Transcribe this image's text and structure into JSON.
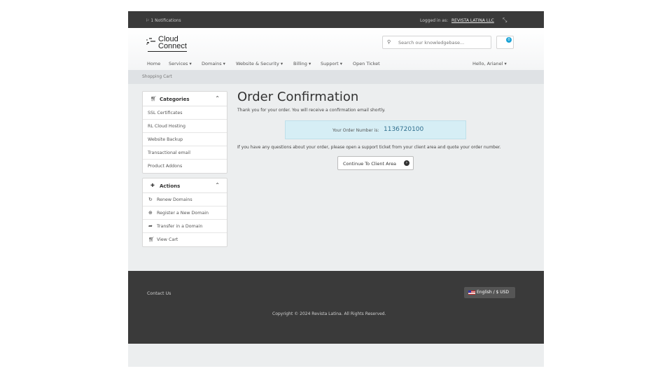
{
  "topbar": {
    "notifications": "1 Notifications",
    "logged_in_label": "Logged in as:",
    "account_name": "REVISTA LATINA LLC"
  },
  "header": {
    "logo_line1": "Cloud",
    "logo_line2": "Connect",
    "search_placeholder": "Search our knowledgebase...",
    "cart_count": "0"
  },
  "nav": {
    "items": [
      "Home",
      "Services ▾",
      "Domains ▾",
      "Website & Security ▾",
      "Billing ▾",
      "Support ▾",
      "Open Ticket"
    ],
    "greeting": "Hello, Arianel ▾"
  },
  "breadcrumb": "Shopping Cart",
  "sidebar": {
    "categories_title": "Categories",
    "categories": [
      "SSL Certificates",
      "RL Cloud Hosting",
      "Website Backup",
      "Transactional email",
      "Product Addons"
    ],
    "actions_title": "Actions",
    "actions": [
      "Renew Domains",
      "Register a New Domain",
      "Transfer in a Domain",
      "View Cart"
    ]
  },
  "main": {
    "title": "Order Confirmation",
    "thanks": "Thank you for your order. You will receive a confirmation email shortly.",
    "order_label": "Your Order Number is:",
    "order_number": "1136720100",
    "questions": "If you have any questions about your order, please open a support ticket from your client area and quote your order number.",
    "continue_button": "Continue To Client Area"
  },
  "footer": {
    "contact": "Contact Us",
    "language": "English / $ USD",
    "copyright": "Copyright © 2024 Revista Latina. All Rights Reserved."
  },
  "colors": {
    "topbar": "#3a3a3a",
    "accent": "#1ba3d6",
    "order_box": "#d6eef5"
  }
}
